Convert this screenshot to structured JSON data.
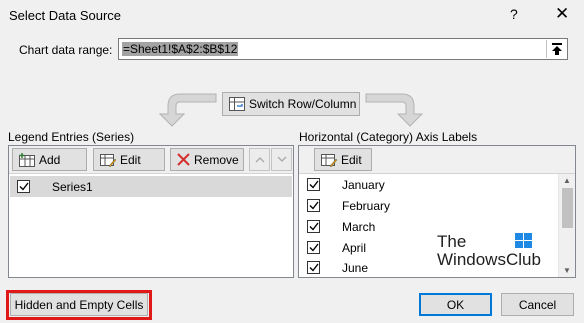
{
  "window": {
    "title": "Select Data Source",
    "help_label": "?",
    "close_label": "✕"
  },
  "range": {
    "label": "Chart data range:",
    "value": "=Sheet1!$A$2:$B$12"
  },
  "switch_button": {
    "label": "Switch Row/Column"
  },
  "legend": {
    "label": "Legend Entries (Series)",
    "add_label": "Add",
    "edit_label": "Edit",
    "remove_label": "Remove",
    "series": [
      {
        "name": "Series1",
        "checked": true
      }
    ]
  },
  "axis": {
    "label": "Horizontal (Category) Axis Labels",
    "edit_label": "Edit",
    "categories": [
      {
        "name": "January",
        "checked": true
      },
      {
        "name": "February",
        "checked": true
      },
      {
        "name": "March",
        "checked": true
      },
      {
        "name": "April",
        "checked": true
      },
      {
        "name": "June",
        "checked": true
      }
    ]
  },
  "watermark": {
    "line1": "The",
    "line2": "WindowsClub"
  },
  "footer": {
    "hidden_cells_label": "Hidden and Empty Cells",
    "ok_label": "OK",
    "cancel_label": "Cancel"
  },
  "colors": {
    "highlight_outline": "#e01818",
    "default_button_border": "#0078d7",
    "remove_icon": "#d32f2f"
  }
}
